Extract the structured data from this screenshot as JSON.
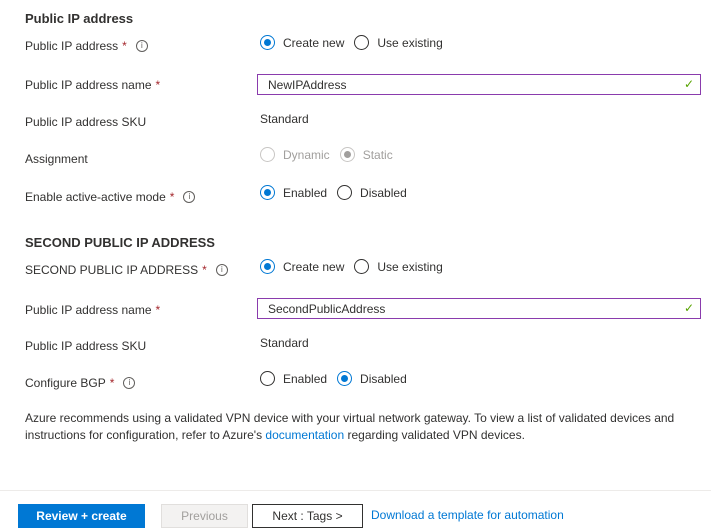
{
  "sections": {
    "public_ip_title": "Public IP address",
    "second_ip_title": "SECOND PUBLIC IP ADDRESS"
  },
  "first_ip": {
    "public_ip_label": "Public IP address",
    "create_new": "Create new",
    "use_existing": "Use existing",
    "name_label": "Public IP address name",
    "name_value": "NewIPAddress",
    "sku_label": "Public IP address SKU",
    "sku_value": "Standard",
    "assignment_label": "Assignment",
    "dynamic": "Dynamic",
    "static": "Static",
    "active_active_label": "Enable active-active mode",
    "enabled": "Enabled",
    "disabled": "Disabled"
  },
  "second_ip": {
    "public_ip_label": "SECOND PUBLIC IP ADDRESS",
    "create_new": "Create new",
    "use_existing": "Use existing",
    "name_label": "Public IP address name",
    "name_value": "SecondPublicAddress",
    "sku_label": "Public IP address SKU",
    "sku_value": "Standard",
    "bgp_label": "Configure BGP",
    "enabled": "Enabled",
    "disabled": "Disabled"
  },
  "note": {
    "text_before": "Azure recommends using a validated VPN device with your virtual network gateway. To view a list of validated devices and instructions for configuration, refer to Azure's ",
    "link": "documentation",
    "text_after": " regarding validated VPN devices."
  },
  "footer": {
    "review_create": "Review + create",
    "previous": "Previous",
    "next": "Next : Tags >",
    "download": "Download a template for automation"
  },
  "symbols": {
    "required": "*",
    "info": "i",
    "check": "✓"
  },
  "colors": {
    "accent": "#0078d4",
    "required": "#a4262c",
    "valid": "#57a300",
    "focus_border": "#8a3bad"
  }
}
